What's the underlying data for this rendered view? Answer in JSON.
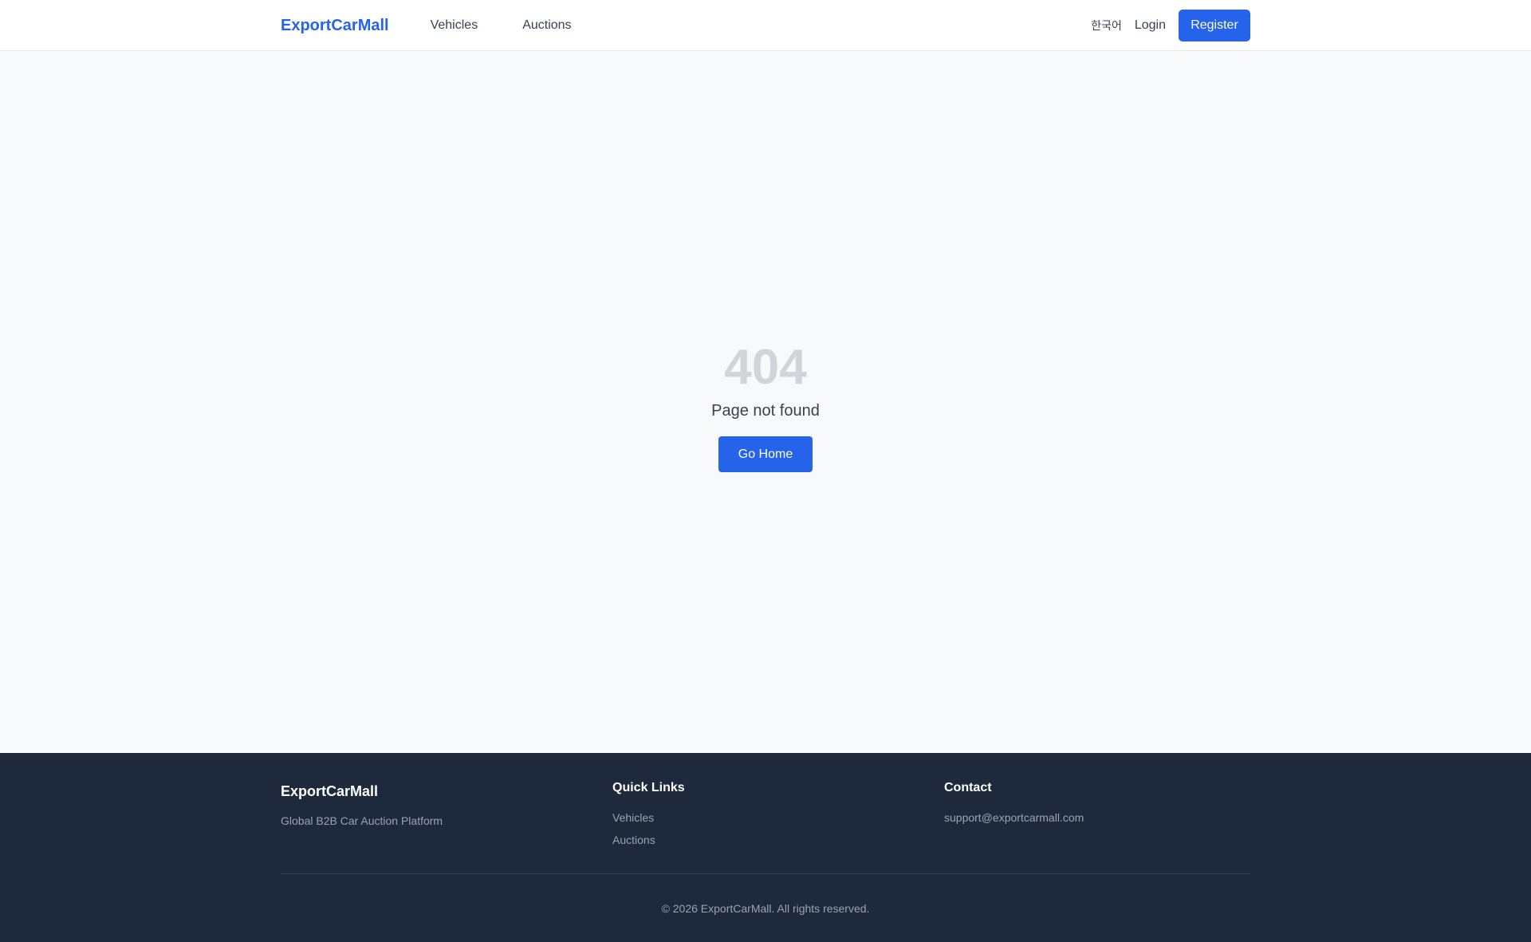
{
  "header": {
    "brand": "ExportCarMall",
    "nav": [
      {
        "label": "Vehicles"
      },
      {
        "label": "Auctions"
      }
    ],
    "language": "한국어",
    "login": "Login",
    "register": "Register"
  },
  "main": {
    "error_code": "404",
    "message": "Page not found",
    "home_button": "Go Home"
  },
  "footer": {
    "brand": "ExportCarMall",
    "tagline": "Global B2B Car Auction Platform",
    "quick_links": {
      "heading": "Quick Links",
      "links": [
        {
          "label": "Vehicles"
        },
        {
          "label": "Auctions"
        }
      ]
    },
    "contact": {
      "heading": "Contact",
      "email": "support@exportcarmall.com"
    },
    "copyright": "© 2026 ExportCarMall. All rights reserved."
  },
  "colors": {
    "primary": "#2563eb",
    "footer_bg": "#1e293b",
    "page_bg": "#f8f9fb",
    "error_code": "#d1d5db"
  }
}
